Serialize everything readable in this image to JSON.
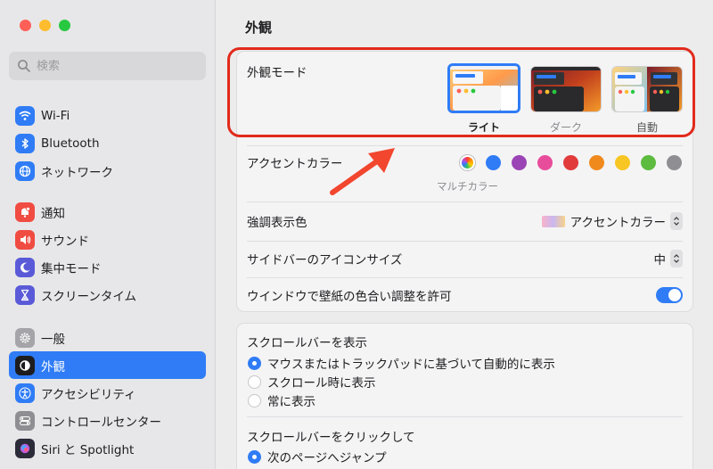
{
  "sidebar": {
    "search_placeholder": "検索",
    "items": [
      {
        "label": "Wi-Fi",
        "icon": "wifi-icon",
        "color": "#2f7cf6"
      },
      {
        "label": "Bluetooth",
        "icon": "bluetooth-icon",
        "color": "#2f7cf6"
      },
      {
        "label": "ネットワーク",
        "icon": "globe-icon",
        "color": "#2f7cf6"
      },
      {
        "label": "通知",
        "icon": "bell-icon",
        "color": "#f04c42"
      },
      {
        "label": "サウンド",
        "icon": "speaker-icon",
        "color": "#f04c42"
      },
      {
        "label": "集中モード",
        "icon": "moon-icon",
        "color": "#5a5ad8"
      },
      {
        "label": "スクリーンタイム",
        "icon": "hourglass-icon",
        "color": "#5a5ad8"
      },
      {
        "label": "一般",
        "icon": "gear-icon",
        "color": "#8e8e93"
      },
      {
        "label": "外観",
        "icon": "appearance-icon",
        "color": "#1d1d1f"
      },
      {
        "label": "アクセシビリティ",
        "icon": "accessibility-icon",
        "color": "#2f7cf6"
      },
      {
        "label": "コントロールセンター",
        "icon": "control-center-icon",
        "color": "#8e8e93"
      },
      {
        "label": "Siri と Spotlight",
        "icon": "siri-icon",
        "color": "#2b2b3a"
      }
    ]
  },
  "main": {
    "title": "外観",
    "appearance_mode": {
      "label": "外観モード",
      "options": [
        {
          "label": "ライト",
          "selected": true
        },
        {
          "label": "ダーク",
          "selected": false
        },
        {
          "label": "自動",
          "selected": false
        }
      ]
    },
    "accent_color": {
      "label": "アクセントカラー",
      "caption": "マルチカラー",
      "colors": [
        "#2f7cf6",
        "#9b44b6",
        "#e84d9b",
        "#e13b3b",
        "#f18a1d",
        "#f8c623",
        "#5dbb3f",
        "#8e8e93"
      ]
    },
    "highlight_color": {
      "label": "強調表示色",
      "value": "アクセントカラー"
    },
    "sidebar_icon_size": {
      "label": "サイドバーのアイコンサイズ",
      "value": "中"
    },
    "wallpaper_tinting": {
      "label": "ウインドウで壁紙の色合い調整を許可",
      "enabled": true
    },
    "show_scrollbars": {
      "label": "スクロールバーを表示",
      "options": [
        {
          "label": "マウスまたはトラックパッドに基づいて自動的に表示",
          "selected": true
        },
        {
          "label": "スクロール時に表示",
          "selected": false
        },
        {
          "label": "常に表示",
          "selected": false
        }
      ]
    },
    "click_scrollbar": {
      "label": "スクロールバーをクリックして",
      "options": [
        {
          "label": "次のページへジャンプ",
          "selected": true
        }
      ]
    }
  }
}
